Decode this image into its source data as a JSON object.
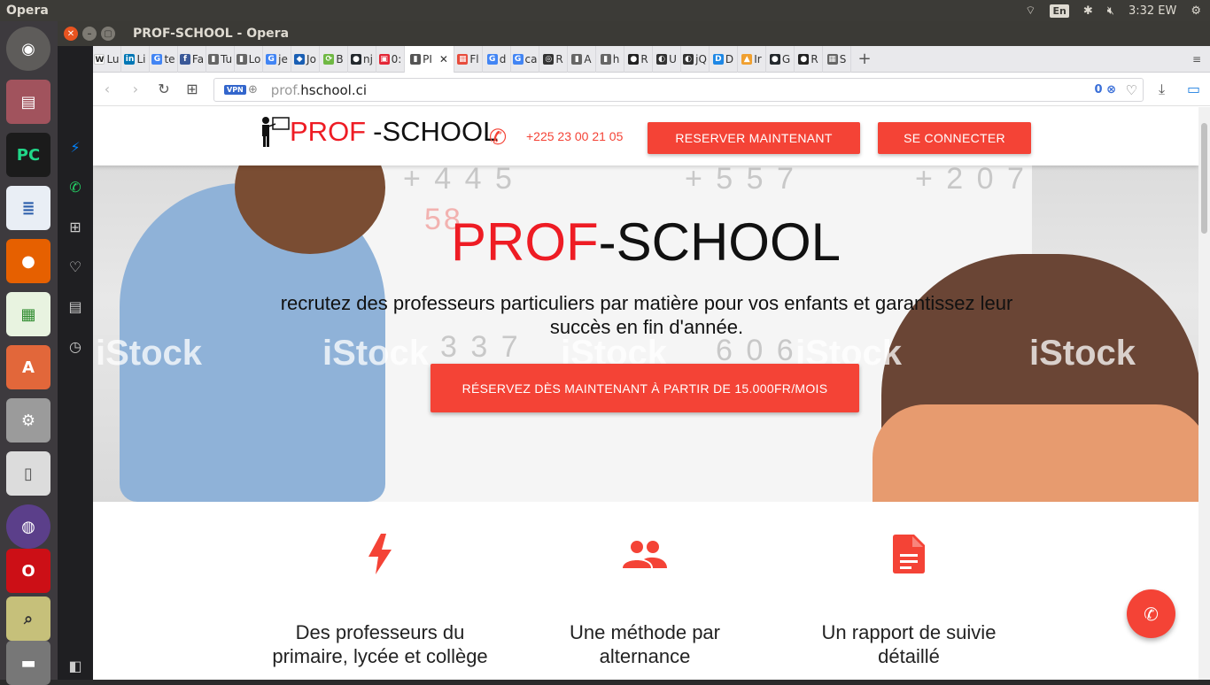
{
  "top_panel": {
    "app_name": "Opera",
    "language": "En",
    "clock": "3:32 EW"
  },
  "window": {
    "title": "PROF-SCHOOL - Opera"
  },
  "tabs": [
    {
      "favicon": "W",
      "label": "Lu",
      "color": "#ffffff"
    },
    {
      "favicon": "in",
      "label": "Li",
      "color": "#0077b5"
    },
    {
      "favicon": "G",
      "label": "te",
      "color": "#4285f4"
    },
    {
      "favicon": "f",
      "label": "Fa",
      "color": "#3b5998"
    },
    {
      "favicon": "▮",
      "label": "Tu",
      "color": "#666666"
    },
    {
      "favicon": "▮",
      "label": "Lo",
      "color": "#666666"
    },
    {
      "favicon": "G",
      "label": "je",
      "color": "#4285f4"
    },
    {
      "favicon": "◆",
      "label": "Jo",
      "color": "#1a5fb4"
    },
    {
      "favicon": "⟳",
      "label": "B",
      "color": "#6fb843"
    },
    {
      "favicon": "●",
      "label": "nj",
      "color": "#24292e"
    },
    {
      "favicon": "▣",
      "label": "0:",
      "color": "#e32636"
    },
    {
      "favicon": "▮",
      "label": "PI",
      "color": "#555555",
      "active": true
    },
    {
      "favicon": "▦",
      "label": "Fl",
      "color": "#e74c3c"
    },
    {
      "favicon": "G",
      "label": "d",
      "color": "#4285f4"
    },
    {
      "favicon": "G",
      "label": "ca",
      "color": "#4285f4"
    },
    {
      "favicon": "◎",
      "label": "R",
      "color": "#333333"
    },
    {
      "favicon": "▮",
      "label": "A",
      "color": "#666666"
    },
    {
      "favicon": "▮",
      "label": "h",
      "color": "#666666"
    },
    {
      "favicon": "●",
      "label": "R",
      "color": "#222222"
    },
    {
      "favicon": "◐",
      "label": "U",
      "color": "#333333"
    },
    {
      "favicon": "◐",
      "label": "jQ",
      "color": "#333333"
    },
    {
      "favicon": "D",
      "label": "D",
      "color": "#1e88e5"
    },
    {
      "favicon": "▲",
      "label": "Ir",
      "color": "#f0a030"
    },
    {
      "favicon": "●",
      "label": "G",
      "color": "#24292e"
    },
    {
      "favicon": "●",
      "label": "R",
      "color": "#222222"
    },
    {
      "favicon": "▦",
      "label": "S",
      "color": "#666666"
    }
  ],
  "address_bar": {
    "vpn": "VPN",
    "url_prefix": "prof.",
    "url_domain": "hschool.ci",
    "adblock_count": "0"
  },
  "site": {
    "logo_red": "PROF",
    "logo_dark": "-SCHOOL",
    "phone": "+225 23 00 21 05",
    "reserve_button": "RESERVER MAINTENANT",
    "login_button": "SE CONNECTER",
    "hero_title_red": "PROF",
    "hero_title_dark": "-SCHOOL",
    "hero_text": "recrutez des professeurs particuliers par matière pour vos enfants et garantissez leur succès en fin d'année.",
    "hero_button": "RÉSERVEZ DÈS MAINTENANT À PARTIR DE 15.000FR/MOIS",
    "board_numbers": [
      "+ 4 4 5",
      "+ 5 5 7",
      "+ 2 0 7",
      "3 3 7",
      "6 0 6",
      "58"
    ],
    "watermark": "iStock"
  },
  "features": [
    {
      "icon": "bolt-icon",
      "text": "Des professeurs du primaire, lycée et collège"
    },
    {
      "icon": "people-icon",
      "text": "Une méthode par alternance"
    },
    {
      "icon": "document-icon",
      "text": "Un rapport de suivie détaillé"
    }
  ],
  "colors": {
    "accent": "#f44336",
    "logo_red": "#ee1c24"
  }
}
